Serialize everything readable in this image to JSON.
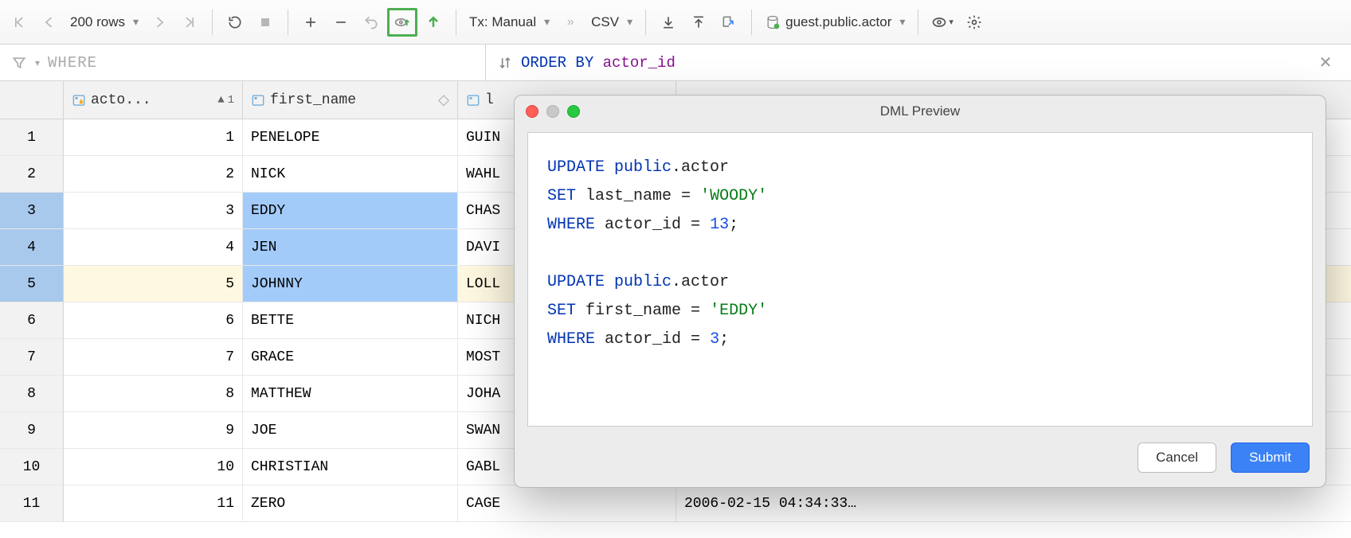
{
  "toolbar": {
    "rows_label": "200 rows",
    "tx_label": "Tx: Manual",
    "format_label": "CSV",
    "datasource_label": "guest.public.actor"
  },
  "filter": {
    "where_placeholder": "WHERE",
    "order_kw": "ORDER BY",
    "order_col": "actor_id"
  },
  "columns": {
    "c1": "acto...",
    "c1_sort": "1",
    "c2": "first_name",
    "c3": "l",
    "c4": ""
  },
  "rows": [
    {
      "n": "1",
      "id": "1",
      "first": "PENELOPE",
      "last": "GUIN",
      "ts": ""
    },
    {
      "n": "2",
      "id": "2",
      "first": "NICK",
      "last": "WAHL",
      "ts": ""
    },
    {
      "n": "3",
      "id": "3",
      "first": "EDDY",
      "last": "CHAS",
      "ts": ""
    },
    {
      "n": "4",
      "id": "4",
      "first": "JEN",
      "last": "DAVI",
      "ts": ""
    },
    {
      "n": "5",
      "id": "5",
      "first": "JOHNNY",
      "last": "LOLL",
      "ts": ""
    },
    {
      "n": "6",
      "id": "6",
      "first": "BETTE",
      "last": "NICH",
      "ts": ""
    },
    {
      "n": "7",
      "id": "7",
      "first": "GRACE",
      "last": "MOST",
      "ts": ""
    },
    {
      "n": "8",
      "id": "8",
      "first": "MATTHEW",
      "last": "JOHA",
      "ts": ""
    },
    {
      "n": "9",
      "id": "9",
      "first": "JOE",
      "last": "SWAN",
      "ts": ""
    },
    {
      "n": "10",
      "id": "10",
      "first": "CHRISTIAN",
      "last": "GABL",
      "ts": ""
    },
    {
      "n": "11",
      "id": "11",
      "first": "ZERO",
      "last": "CAGE",
      "ts": "2006-02-15 04:34:33…"
    }
  ],
  "dialog": {
    "title": "DML Preview",
    "sql": {
      "l1_update": "UPDATE",
      "l1_schema": "public",
      "l1_table": ".actor",
      "l2_set": "SET",
      "l2_col": "last_name = ",
      "l2_val": "'WOODY'",
      "l3_where": "WHERE",
      "l3_col": "actor_id = ",
      "l3_val": "13",
      "l3_end": ";",
      "l4_update": "UPDATE",
      "l4_schema": "public",
      "l4_table": ".actor",
      "l5_set": "SET",
      "l5_col": "first_name = ",
      "l5_val": "'EDDY'",
      "l6_where": "WHERE",
      "l6_col": "actor_id = ",
      "l6_val": "3",
      "l6_end": ";"
    },
    "cancel": "Cancel",
    "submit": "Submit"
  }
}
